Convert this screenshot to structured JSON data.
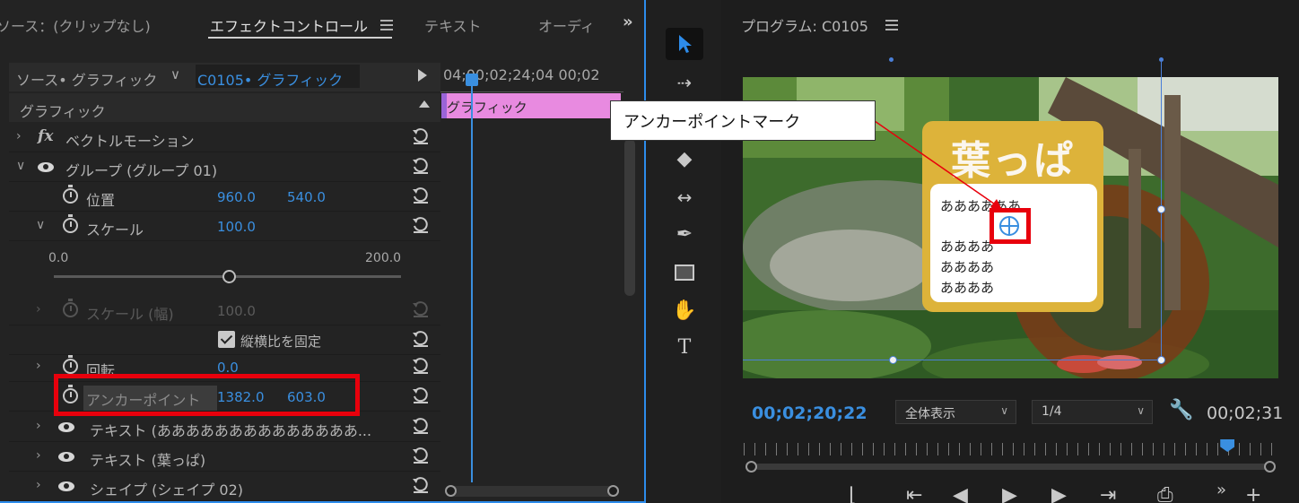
{
  "effect_controls": {
    "tabs": [
      {
        "label": "ソース：(クリップなし)"
      },
      {
        "label": "エフェクトコントロール"
      },
      {
        "label": "テキスト"
      },
      {
        "label": "オーディ"
      }
    ],
    "source_label": "ソース• グラフィック",
    "clip_label": "C0105• グラフィック",
    "section_title": "グラフィック",
    "properties": {
      "vector_motion": "ベクトルモーション",
      "group": "グループ (グループ 01)",
      "position": {
        "label": "位置",
        "x": "960.0",
        "y": "540.0"
      },
      "scale": {
        "label": "スケール",
        "value": "100.0"
      },
      "scale_min": "0.0",
      "scale_max": "200.0",
      "scale_width": {
        "label": "スケール (幅)",
        "value": "100.0"
      },
      "uniform_scale": "縦横比を固定",
      "uniform_scale_checked": true,
      "rotation": {
        "label": "回転",
        "value": "0.0"
      },
      "anchor_point": {
        "label": "アンカーポイント",
        "x": "1382.0",
        "y": "603.0"
      },
      "text_layer_1": "テキスト (ああああああああああああああ...",
      "text_layer_2": "テキスト (葉っぱ)",
      "shape_layer": "シェイプ (シェイプ 02)"
    },
    "timeline": {
      "timecode": "04;00;02;24;04 00;02",
      "clip_label": "グラフィック"
    }
  },
  "program_monitor": {
    "title": "プログラム: C0105",
    "card": {
      "title": "葉っぱ",
      "lines": [
        "ああああああ",
        "ああああ",
        "ああああ",
        "ああああ"
      ]
    },
    "callout": "アンカーポイントマーク",
    "timecode_current": "00;02;20;22",
    "zoom": "全体表示",
    "resolution": "1/4",
    "timecode_duration": "00;02;31",
    "playhead_fraction": 0.92
  },
  "colors": {
    "accent_blue": "#3a8fe0",
    "highlight_red": "#e8000c",
    "clip_pink": "#e88ae0",
    "card_yellow": "#ddb33a"
  }
}
